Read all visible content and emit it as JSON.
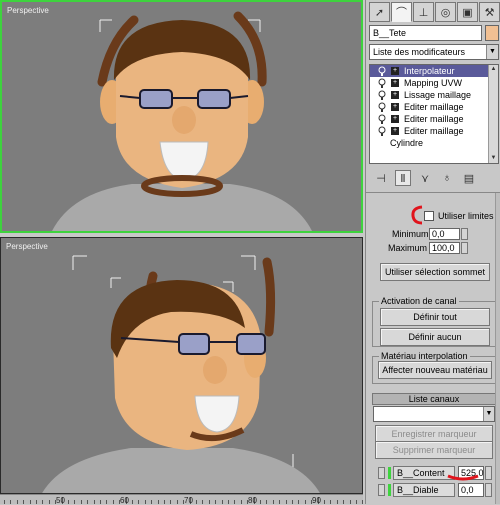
{
  "viewports": {
    "top": {
      "label": "Perspective",
      "active": true
    },
    "bottom": {
      "label": "Perspective",
      "active": false
    }
  },
  "ruler": {
    "ticks": [
      "50",
      "60",
      "70",
      "80",
      "90",
      "100"
    ]
  },
  "panel": {
    "tab_icons": [
      "cursor-icon",
      "curve-icon",
      "hierarchy-icon",
      "motion-icon",
      "display-icon",
      "utilities-icon"
    ],
    "object_name": "B__Tete",
    "object_color": "#f1c093",
    "modifier_list_label": "Liste des modificateurs",
    "stack": [
      {
        "label": "Interpolateur",
        "selected": true,
        "base": false
      },
      {
        "label": "Mapping UVW",
        "selected": false,
        "base": false
      },
      {
        "label": "Lissage maillage",
        "selected": false,
        "base": false
      },
      {
        "label": "Editer maillage",
        "selected": false,
        "base": false
      },
      {
        "label": "Editer maillage",
        "selected": false,
        "base": false
      },
      {
        "label": "Editer maillage",
        "selected": false,
        "base": false
      },
      {
        "label": "Cylindre",
        "selected": false,
        "base": true
      }
    ],
    "limits": {
      "use_limits_label": "Utiliser limites",
      "minimum_label": "Minimum:",
      "minimum_value": "0,0",
      "maximum_label": "Maximum :",
      "maximum_value": "100,0",
      "use_vertex_selection_label": "Utiliser sélection sommet"
    },
    "channel_activation": {
      "title": "Activation de canal",
      "define_all_label": "Définir tout",
      "define_none_label": "Définir aucun"
    },
    "material_interpolation": {
      "title": "Matériau interpolation",
      "assign_new_material_label": "Affecter nouveau matériau"
    },
    "channel_list": {
      "title": "Liste canaux",
      "save_marker_label": "Enregistrer marqueur",
      "delete_marker_label": "Supprimer marqueur",
      "channels": [
        {
          "name": "B__Content",
          "value": "525,0"
        },
        {
          "name": "B__Diable",
          "value": "0,0"
        }
      ]
    },
    "annotation_color": "#e0141c",
    "active_color": "#3ed33e"
  }
}
